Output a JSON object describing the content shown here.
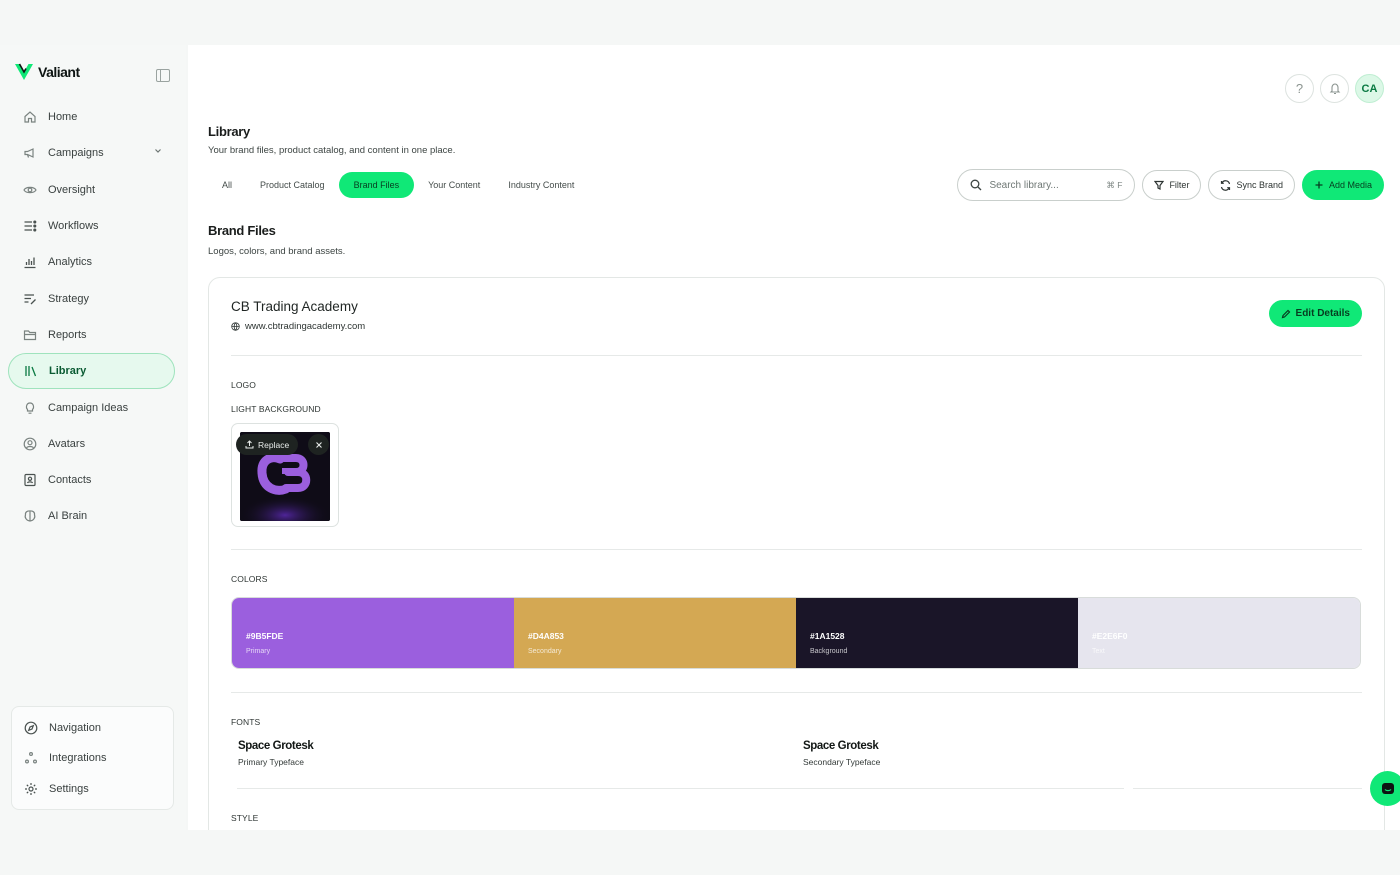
{
  "brand": {
    "name": "Valiant"
  },
  "sidebar": {
    "items": [
      {
        "label": "Home",
        "icon": "home-icon"
      },
      {
        "label": "Campaigns",
        "icon": "megaphone-icon"
      },
      {
        "label": "Oversight",
        "icon": "eye-icon"
      },
      {
        "label": "Workflows",
        "icon": "workflow-icon"
      },
      {
        "label": "Analytics",
        "icon": "bar-chart-icon"
      },
      {
        "label": "Strategy",
        "icon": "strategy-icon"
      },
      {
        "label": "Reports",
        "icon": "folder-icon"
      },
      {
        "label": "Library",
        "icon": "library-icon",
        "active": true
      },
      {
        "label": "Campaign Ideas",
        "icon": "lightbulb-icon"
      },
      {
        "label": "Avatars",
        "icon": "user-circle-icon"
      },
      {
        "label": "Contacts",
        "icon": "contacts-icon"
      },
      {
        "label": "AI Brain",
        "icon": "brain-icon"
      }
    ],
    "bottom": [
      {
        "label": "Navigation",
        "icon": "compass-icon"
      },
      {
        "label": "Integrations",
        "icon": "integrations-icon"
      },
      {
        "label": "Settings",
        "icon": "gear-icon"
      }
    ]
  },
  "header": {
    "help": "?",
    "avatar_initials": "CA"
  },
  "page": {
    "title": "Library",
    "subtitle": "Your brand files, product catalog, and content in one place."
  },
  "tabs": [
    "All",
    "Product Catalog",
    "Brand Files",
    "Your Content",
    "Industry Content"
  ],
  "active_tab": "Brand Files",
  "toolbar": {
    "search_placeholder": "Search library...",
    "shortcut": "⌘ F",
    "filter": "Filter",
    "sync": "Sync Brand",
    "add": "Add Media"
  },
  "section": {
    "title": "Brand Files",
    "subtitle": "Logos, colors, and brand assets."
  },
  "card": {
    "name": "CB Trading Academy",
    "url": "www.cbtradingacademy.com",
    "edit": "Edit Details",
    "logo_label": "LOGO",
    "light_bg_label": "LIGHT BACKGROUND",
    "replace": "Replace",
    "colors_label": "COLORS",
    "colors": [
      {
        "hex": "#9B5FDE",
        "role": "Primary",
        "value": "#9b5fde"
      },
      {
        "hex": "#D4A853",
        "role": "Secondary",
        "value": "#d4a853"
      },
      {
        "hex": "#1A1528",
        "role": "Background",
        "value": "#1a1528"
      },
      {
        "hex": "#E2E6F0",
        "role": "Text",
        "value": "#e6e5ee"
      }
    ],
    "fonts_label": "FONTS",
    "fonts": [
      {
        "name": "Space Grotesk",
        "role": "Primary Typeface"
      },
      {
        "name": "Space Grotesk",
        "role": "Secondary Typeface"
      }
    ],
    "style_label": "STYLE"
  },
  "colors": {
    "accent": "#10e877",
    "accent_text": "#063d20",
    "active_bg": "#e6f9ee"
  }
}
